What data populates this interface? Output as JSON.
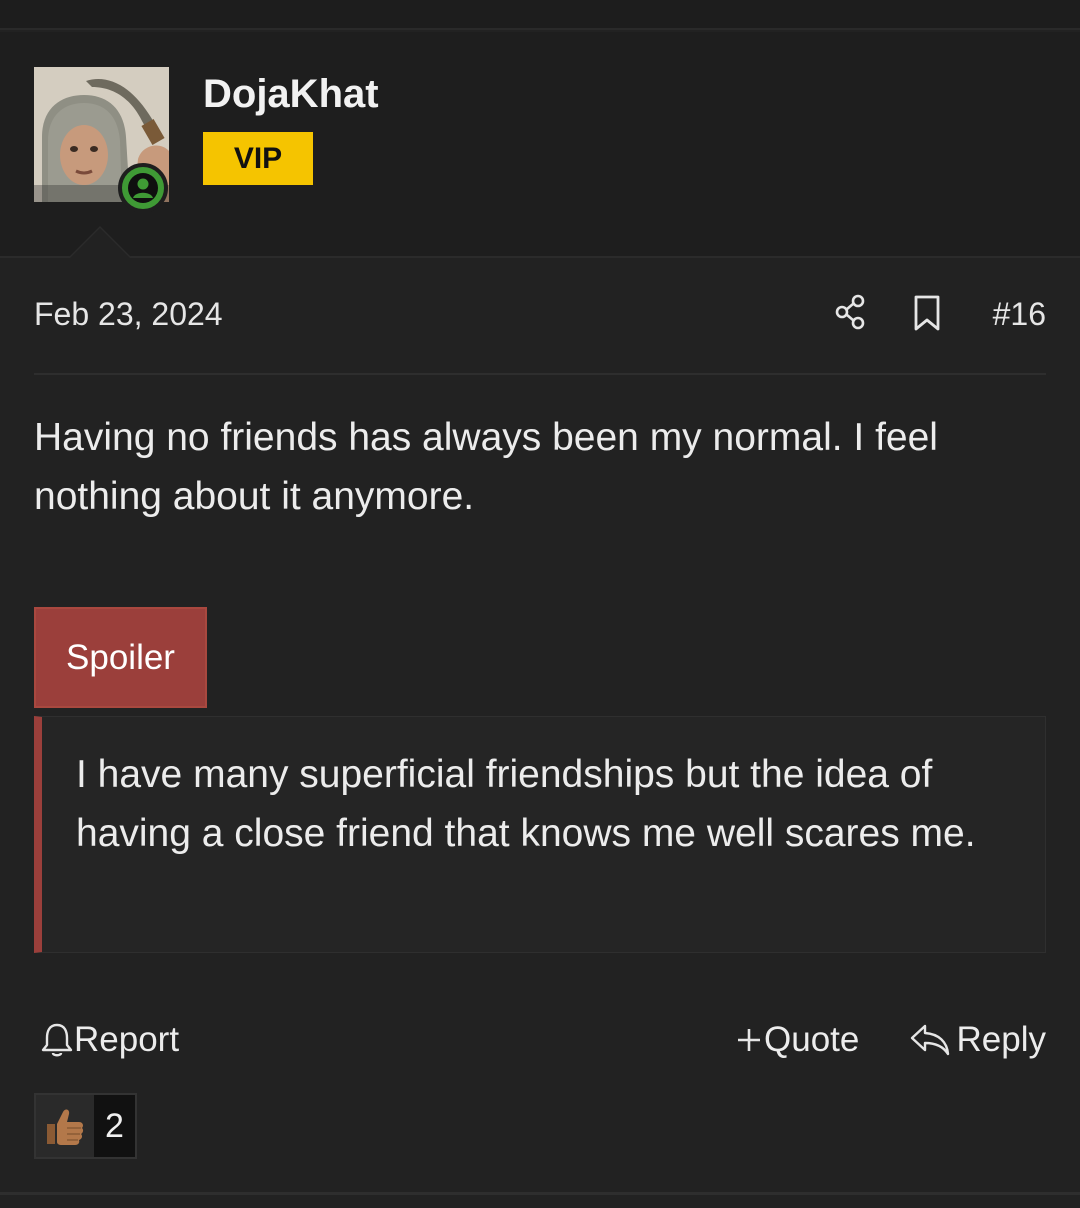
{
  "user": {
    "name": "DojaKhat",
    "badge": "VIP",
    "avatar_icon": "user-avatar-photo",
    "online_icon": "user-online-icon",
    "badge_color": "#f5c400",
    "online_color": "#3f9a35"
  },
  "post": {
    "date": "Feb 23, 2024",
    "number": "#16",
    "body": "Having no friends has always been my normal. I feel nothing about it anymore.",
    "spoiler_label": "Spoiler",
    "spoiler_text": "I have many superficial friendships but the idea of having a close friend that knows me well scares me.",
    "spoiler_color": "#9b3f3b"
  },
  "actions": {
    "report": "Report",
    "quote": "Quote",
    "reply": "Reply"
  },
  "reactions": {
    "icon": "thumbs-up",
    "count": "2"
  }
}
